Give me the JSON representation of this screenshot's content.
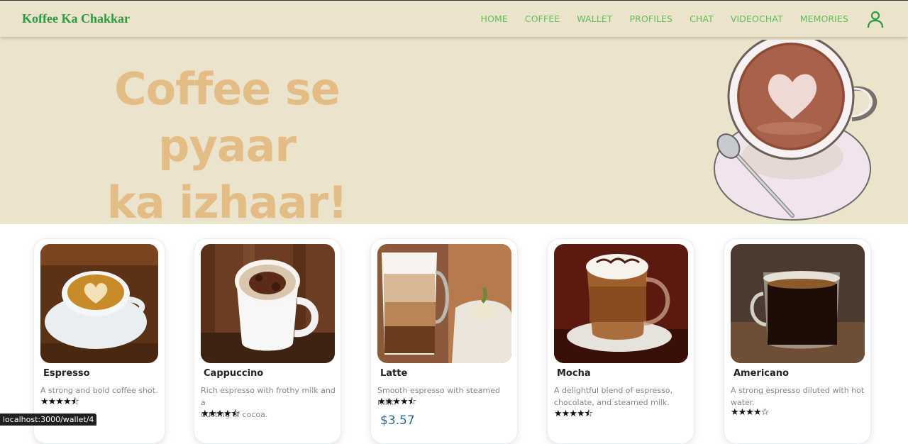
{
  "nav": {
    "brand": "Koffee Ka Chakkar",
    "links": [
      "HOME",
      "COFFEE",
      "WALLET",
      "PROFILES",
      "CHAT",
      "VIDEOCHAT",
      "MEMORIES"
    ]
  },
  "hero": {
    "title_line1": "Coffee se pyaar",
    "title_line2": "ka izhaar!"
  },
  "cards": [
    {
      "name": "Espresso",
      "description": "A strong and bold coffee shot.",
      "rating_stars": "★★★★⯪"
    },
    {
      "name": "Cappuccino",
      "description_line1": "Rich espresso with frothy milk and a",
      "description_line2": "dusting of cocoa.",
      "rating_stars": "★★★★⯪"
    },
    {
      "name": "Latte",
      "description": "Smooth espresso with steamed milk.",
      "rating_stars": "★★★★⯪",
      "price": "$3.57"
    },
    {
      "name": "Mocha",
      "description_line1": "A delightful blend of espresso,",
      "description_line2": "chocolate, and steamed milk.",
      "rating_stars": "★★★★⯪"
    },
    {
      "name": "Americano",
      "description_line1": "A strong espresso diluted with hot",
      "description_line2": "water.",
      "rating_stars": "★★★★☆"
    }
  ],
  "status_bar": {
    "url": "localhost:3000/wallet/4"
  },
  "colors": {
    "brand": "#2c9a3f",
    "nav_link": "#5fbf55",
    "hero_bg": "#ebe3cc",
    "hero_text": "#e3bd85",
    "price": "#2b6d8a"
  }
}
